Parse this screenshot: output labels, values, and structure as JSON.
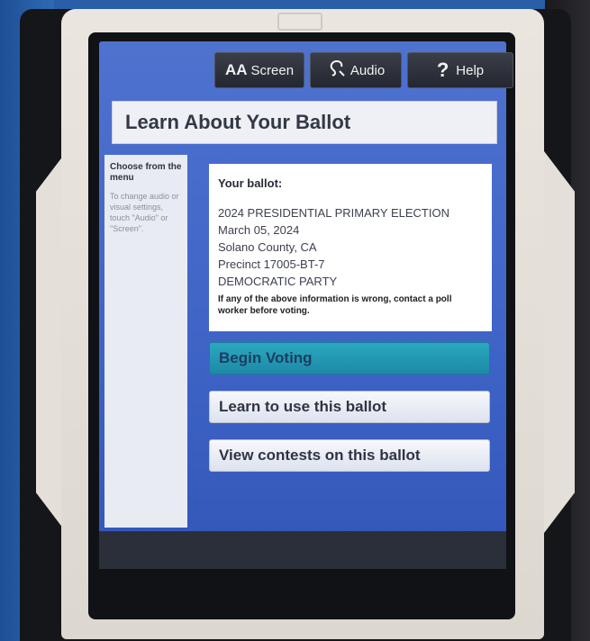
{
  "toolbar": {
    "screen_icon_text": "AA",
    "screen_label": "Screen",
    "audio_label": "Audio",
    "help_icon_text": "?",
    "help_label": "Help"
  },
  "page": {
    "title": "Learn About Your Ballot"
  },
  "sidebar": {
    "heading": "Choose from the menu",
    "note": "To change audio or visual settings, touch \"Audio\" or \"Screen\"."
  },
  "ballot": {
    "label": "Your ballot:",
    "election": "2024 PRESIDENTIAL PRIMARY ELECTION",
    "date": "March 05, 2024",
    "county": "Solano County, CA",
    "precinct": "Precinct 17005-BT-7",
    "party": "DEMOCRATIC PARTY",
    "warning": "If any of the above information is wrong, contact a poll worker before voting."
  },
  "actions": {
    "begin_voting": "Begin Voting",
    "learn_ballot": "Learn to use this ballot",
    "view_contests": "View contests on this ballot"
  }
}
